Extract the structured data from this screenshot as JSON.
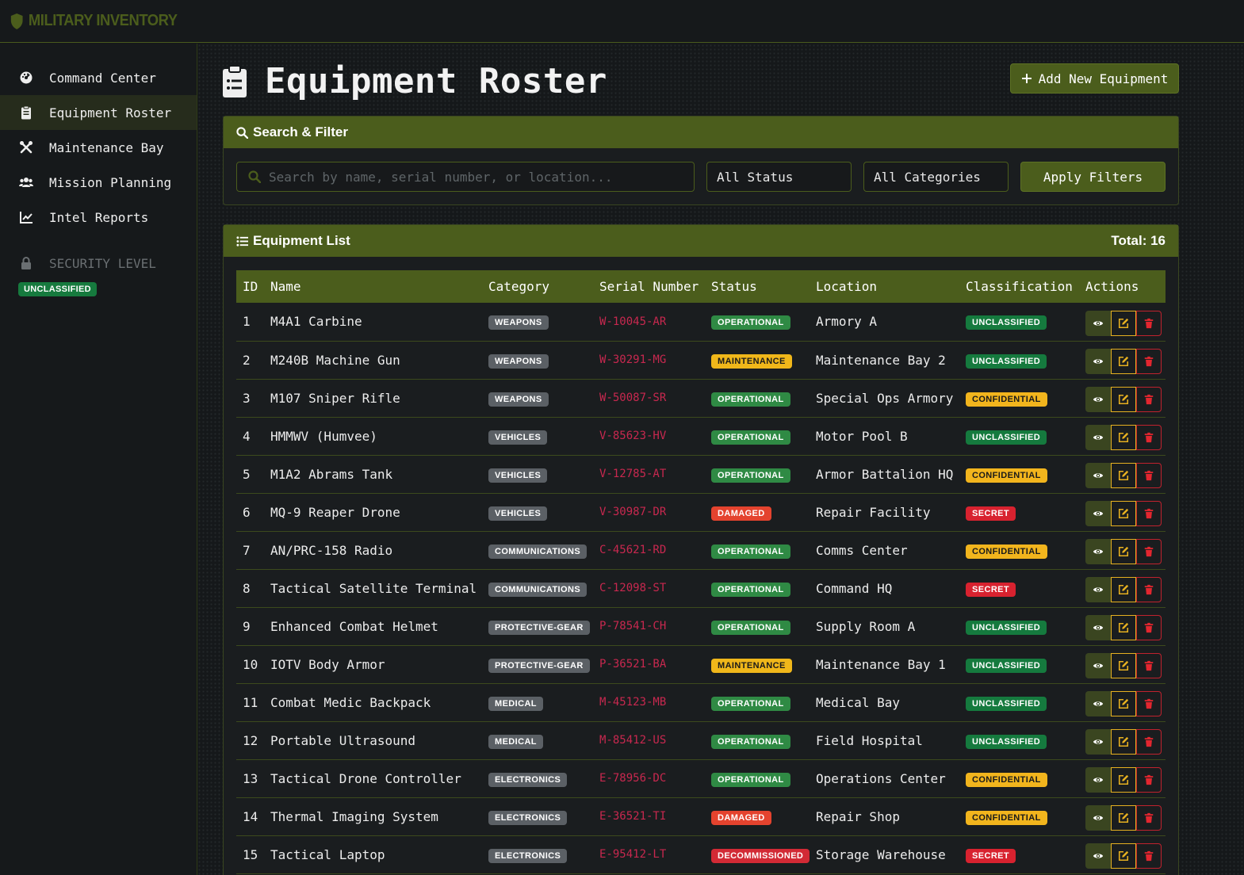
{
  "app": {
    "brand": "MILITARY INVENTORY"
  },
  "sidebar": {
    "items": [
      {
        "label": "Command Center",
        "icon": "dashboard-icon",
        "active": false
      },
      {
        "label": "Equipment Roster",
        "icon": "clipboard-icon",
        "active": true
      },
      {
        "label": "Maintenance Bay",
        "icon": "tools-icon",
        "active": false
      },
      {
        "label": "Mission Planning",
        "icon": "users-icon",
        "active": false
      },
      {
        "label": "Intel Reports",
        "icon": "chart-line-icon",
        "active": false
      }
    ],
    "security_label": "SECURITY LEVEL",
    "security_badge": "UNCLASSIFIED"
  },
  "header": {
    "title": "Equipment Roster",
    "add_button": "Add New Equipment"
  },
  "filter": {
    "title": "Search & Filter",
    "search_placeholder": "Search by name, serial number, or location...",
    "status_value": "All Status",
    "category_value": "All Categories",
    "apply_label": "Apply Filters"
  },
  "list": {
    "title": "Equipment List",
    "total": "Total: 16",
    "columns": [
      "ID",
      "Name",
      "Category",
      "Serial Number",
      "Status",
      "Location",
      "Classification",
      "Actions"
    ],
    "rows": [
      {
        "id": "1",
        "name": "M4A1 Carbine",
        "category": "WEAPONS",
        "serial": "W-10045-AR",
        "status": "OPERATIONAL",
        "location": "Armory A",
        "classification": "UNCLASSIFIED"
      },
      {
        "id": "2",
        "name": "M240B Machine Gun",
        "category": "WEAPONS",
        "serial": "W-30291-MG",
        "status": "MAINTENANCE",
        "location": "Maintenance Bay 2",
        "classification": "UNCLASSIFIED"
      },
      {
        "id": "3",
        "name": "M107 Sniper Rifle",
        "category": "WEAPONS",
        "serial": "W-50087-SR",
        "status": "OPERATIONAL",
        "location": "Special Ops Armory",
        "classification": "CONFIDENTIAL"
      },
      {
        "id": "4",
        "name": "HMMWV (Humvee)",
        "category": "VEHICLES",
        "serial": "V-85623-HV",
        "status": "OPERATIONAL",
        "location": "Motor Pool B",
        "classification": "UNCLASSIFIED"
      },
      {
        "id": "5",
        "name": "M1A2 Abrams Tank",
        "category": "VEHICLES",
        "serial": "V-12785-AT",
        "status": "OPERATIONAL",
        "location": "Armor Battalion HQ",
        "classification": "CONFIDENTIAL"
      },
      {
        "id": "6",
        "name": "MQ-9 Reaper Drone",
        "category": "VEHICLES",
        "serial": "V-30987-DR",
        "status": "DAMAGED",
        "location": "Repair Facility",
        "classification": "SECRET"
      },
      {
        "id": "7",
        "name": "AN/PRC-158 Radio",
        "category": "COMMUNICATIONS",
        "serial": "C-45621-RD",
        "status": "OPERATIONAL",
        "location": "Comms Center",
        "classification": "CONFIDENTIAL"
      },
      {
        "id": "8",
        "name": "Tactical Satellite Terminal",
        "category": "COMMUNICATIONS",
        "serial": "C-12098-ST",
        "status": "OPERATIONAL",
        "location": "Command HQ",
        "classification": "SECRET"
      },
      {
        "id": "9",
        "name": "Enhanced Combat Helmet",
        "category": "PROTECTIVE-GEAR",
        "serial": "P-78541-CH",
        "status": "OPERATIONAL",
        "location": "Supply Room A",
        "classification": "UNCLASSIFIED"
      },
      {
        "id": "10",
        "name": "IOTV Body Armor",
        "category": "PROTECTIVE-GEAR",
        "serial": "P-36521-BA",
        "status": "MAINTENANCE",
        "location": "Maintenance Bay 1",
        "classification": "UNCLASSIFIED"
      },
      {
        "id": "11",
        "name": "Combat Medic Backpack",
        "category": "MEDICAL",
        "serial": "M-45123-MB",
        "status": "OPERATIONAL",
        "location": "Medical Bay",
        "classification": "UNCLASSIFIED"
      },
      {
        "id": "12",
        "name": "Portable Ultrasound",
        "category": "MEDICAL",
        "serial": "M-85412-US",
        "status": "OPERATIONAL",
        "location": "Field Hospital",
        "classification": "UNCLASSIFIED"
      },
      {
        "id": "13",
        "name": "Tactical Drone Controller",
        "category": "ELECTRONICS",
        "serial": "E-78956-DC",
        "status": "OPERATIONAL",
        "location": "Operations Center",
        "classification": "CONFIDENTIAL"
      },
      {
        "id": "14",
        "name": "Thermal Imaging System",
        "category": "ELECTRONICS",
        "serial": "E-36521-TI",
        "status": "DAMAGED",
        "location": "Repair Shop",
        "classification": "CONFIDENTIAL"
      },
      {
        "id": "15",
        "name": "Tactical Laptop",
        "category": "ELECTRONICS",
        "serial": "E-95412-LT",
        "status": "DECOMMISSIONED",
        "location": "Storage Warehouse",
        "classification": "SECRET"
      }
    ]
  },
  "colors": {
    "accent": "#4b5d1c",
    "background": "#15181a",
    "serial": "#c8284f"
  }
}
